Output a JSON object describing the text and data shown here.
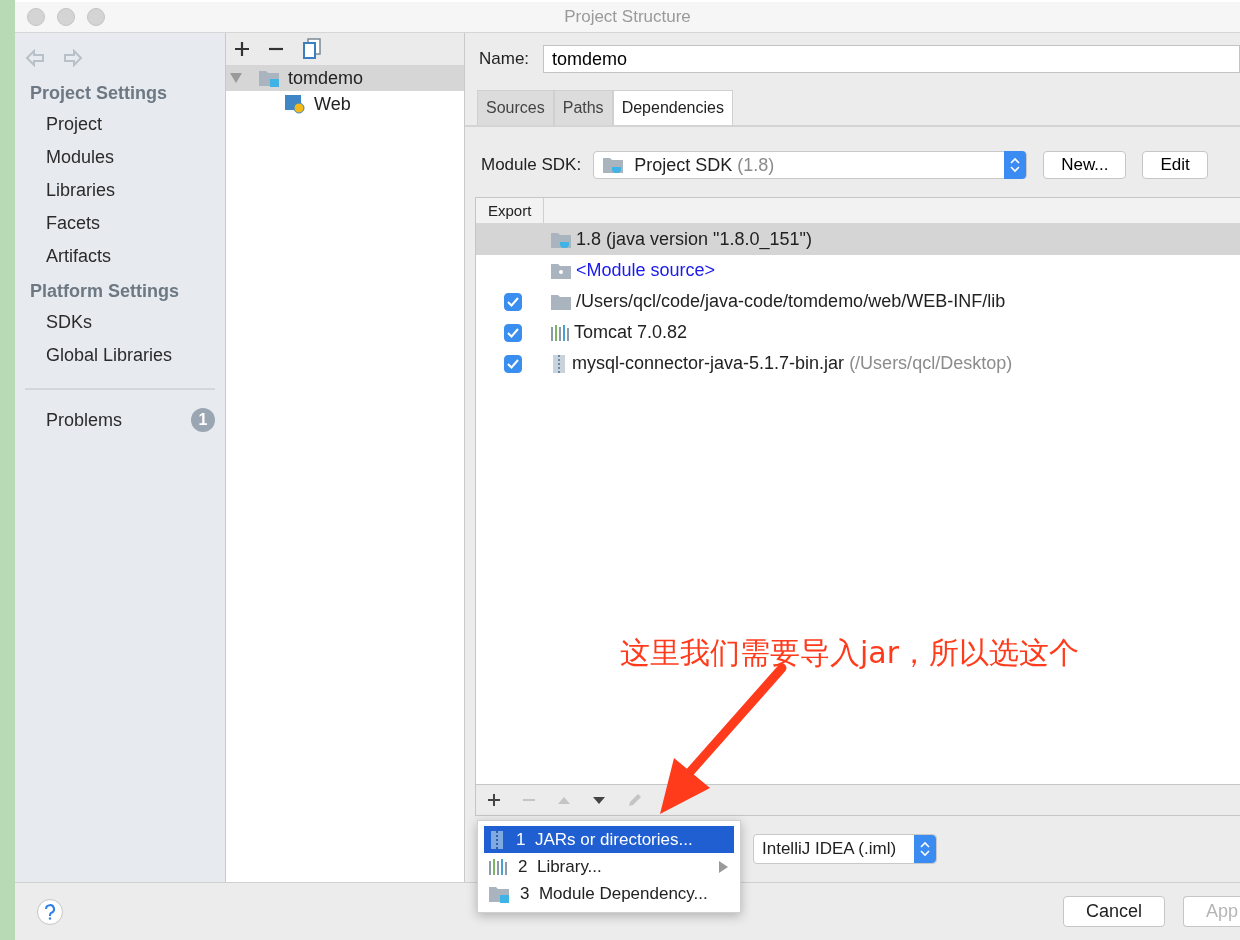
{
  "window": {
    "title": "Project Structure"
  },
  "sidebar": {
    "sections": [
      {
        "title": "Project Settings",
        "items": [
          {
            "label": "Project",
            "selected": false
          },
          {
            "label": "Modules",
            "selected": false
          },
          {
            "label": "Libraries",
            "selected": false
          },
          {
            "label": "Facets",
            "selected": false
          },
          {
            "label": "Artifacts",
            "selected": false
          }
        ]
      },
      {
        "title": "Platform Settings",
        "items": [
          {
            "label": "SDKs",
            "selected": false
          },
          {
            "label": "Global Libraries",
            "selected": false
          }
        ]
      }
    ],
    "problems": {
      "label": "Problems",
      "count": "1"
    }
  },
  "tree": {
    "items": [
      {
        "label": "tomdemo",
        "kind": "module",
        "expanded": true,
        "selected": true,
        "children": [
          {
            "label": "Web",
            "kind": "web",
            "selected": false
          }
        ]
      }
    ]
  },
  "name_field": {
    "label": "Name:",
    "value": "tomdemo"
  },
  "tabs": [
    {
      "label": "Sources",
      "selected": false
    },
    {
      "label": "Paths",
      "selected": false
    },
    {
      "label": "Dependencies",
      "selected": true
    }
  ],
  "module_sdk": {
    "label": "Module SDK:",
    "value": "Project SDK",
    "detail": "(1.8)",
    "buttons": [
      "New...",
      "Edit"
    ]
  },
  "dependencies": {
    "columns": [
      "Export"
    ],
    "rows": [
      {
        "kind": "sdk",
        "label": "1.8 (java version \"1.8.0_151\")",
        "selected": true
      },
      {
        "kind": "source",
        "label": "<Module source>",
        "selected": false
      },
      {
        "kind": "folder",
        "label": "/Users/qcl/code/java-code/tomdemo/web/WEB-INF/lib",
        "export": true,
        "selected": false
      },
      {
        "kind": "library",
        "label": "Tomcat 7.0.82",
        "export": true,
        "selected": false
      },
      {
        "kind": "jar",
        "label": "mysql-connector-java-5.1.7-bin.jar",
        "detail": "(/Users/qcl/Desktop)",
        "export": true,
        "selected": false
      }
    ]
  },
  "toolbar": [
    {
      "kind": "add",
      "disabled": false
    },
    {
      "kind": "remove",
      "disabled": true
    },
    {
      "kind": "up",
      "disabled": true
    },
    {
      "kind": "down",
      "disabled": false
    },
    {
      "kind": "edit",
      "disabled": true
    }
  ],
  "add_menu": {
    "items": [
      {
        "number": "1",
        "label": "JARs or directories...",
        "kind": "jar",
        "selected": true,
        "submenu": false
      },
      {
        "number": "2",
        "label": "Library...",
        "kind": "library",
        "selected": false,
        "submenu": true
      },
      {
        "number": "3",
        "label": "Module Dependency...",
        "kind": "module",
        "selected": false,
        "submenu": false
      }
    ]
  },
  "storage_format": {
    "value": "IntelliJ IDEA (.iml)"
  },
  "footer": {
    "buttons": [
      {
        "label": "Cancel",
        "disabled": false
      },
      {
        "label": "App",
        "disabled": true
      }
    ]
  },
  "annotation": {
    "text": "这里我们需要导入jar，所以选这个"
  }
}
